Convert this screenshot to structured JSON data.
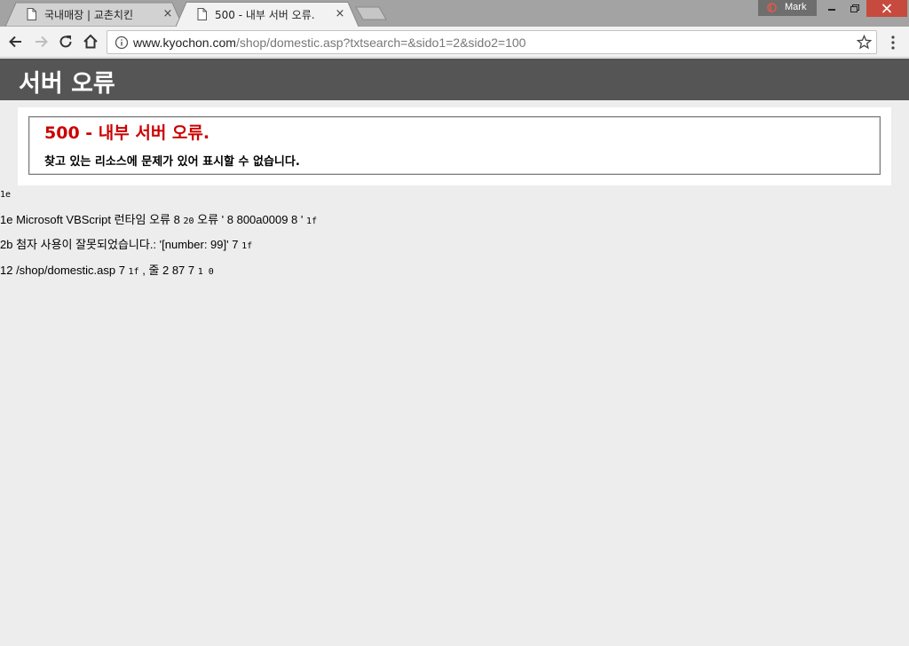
{
  "browser": {
    "tabs": [
      {
        "label": "국내매장 | 교촌치킨",
        "active": false
      },
      {
        "label": "500 - 내부 서버 오류.",
        "active": true
      }
    ],
    "close_glyph": "×",
    "profile_name": "Mark",
    "url_host": "www.kyochon.com",
    "url_path": "/shop/domestic.asp?txtsearch=&sido1=2&sido2=100",
    "icons": [
      "back-icon",
      "forward-icon",
      "reload-icon",
      "home-icon",
      "info-icon",
      "star-icon",
      "menu-icon"
    ]
  },
  "page": {
    "header_title": "서버 오류",
    "error_title": "500 - 내부 서버 오류.",
    "error_desc": "찾고 있는 리소스에 문제가 있어 표시할 수 없습니다.",
    "debug_lines": [
      {
        "parts": [
          {
            "t": "1e",
            "mono": true
          }
        ]
      },
      {
        "parts": [
          {
            "t": "1e Microsoft VBScript 런타임 오류 8 ",
            "mono": false
          },
          {
            "t": "20",
            "mono": true
          },
          {
            "t": " 오류 ' 8 800a0009 8 ' ",
            "mono": false
          },
          {
            "t": "1f",
            "mono": true
          }
        ]
      },
      {
        "parts": [
          {
            "t": "2b 첨자 사용이 잘못되었습니다.: '[number: 99]' 7 ",
            "mono": false
          },
          {
            "t": "1f",
            "mono": true
          }
        ]
      },
      {
        "parts": [
          {
            "t": "12 /shop/domestic.asp 7 ",
            "mono": false
          },
          {
            "t": "1f",
            "mono": true
          },
          {
            "t": " , 줄 2 87 7 ",
            "mono": false
          },
          {
            "t": "1 0",
            "mono": true
          }
        ]
      }
    ]
  },
  "colors": {
    "header_bg": "#555555",
    "error_red": "#cc0000",
    "close_btn": "#c74a3e",
    "page_bg": "#ededed"
  }
}
